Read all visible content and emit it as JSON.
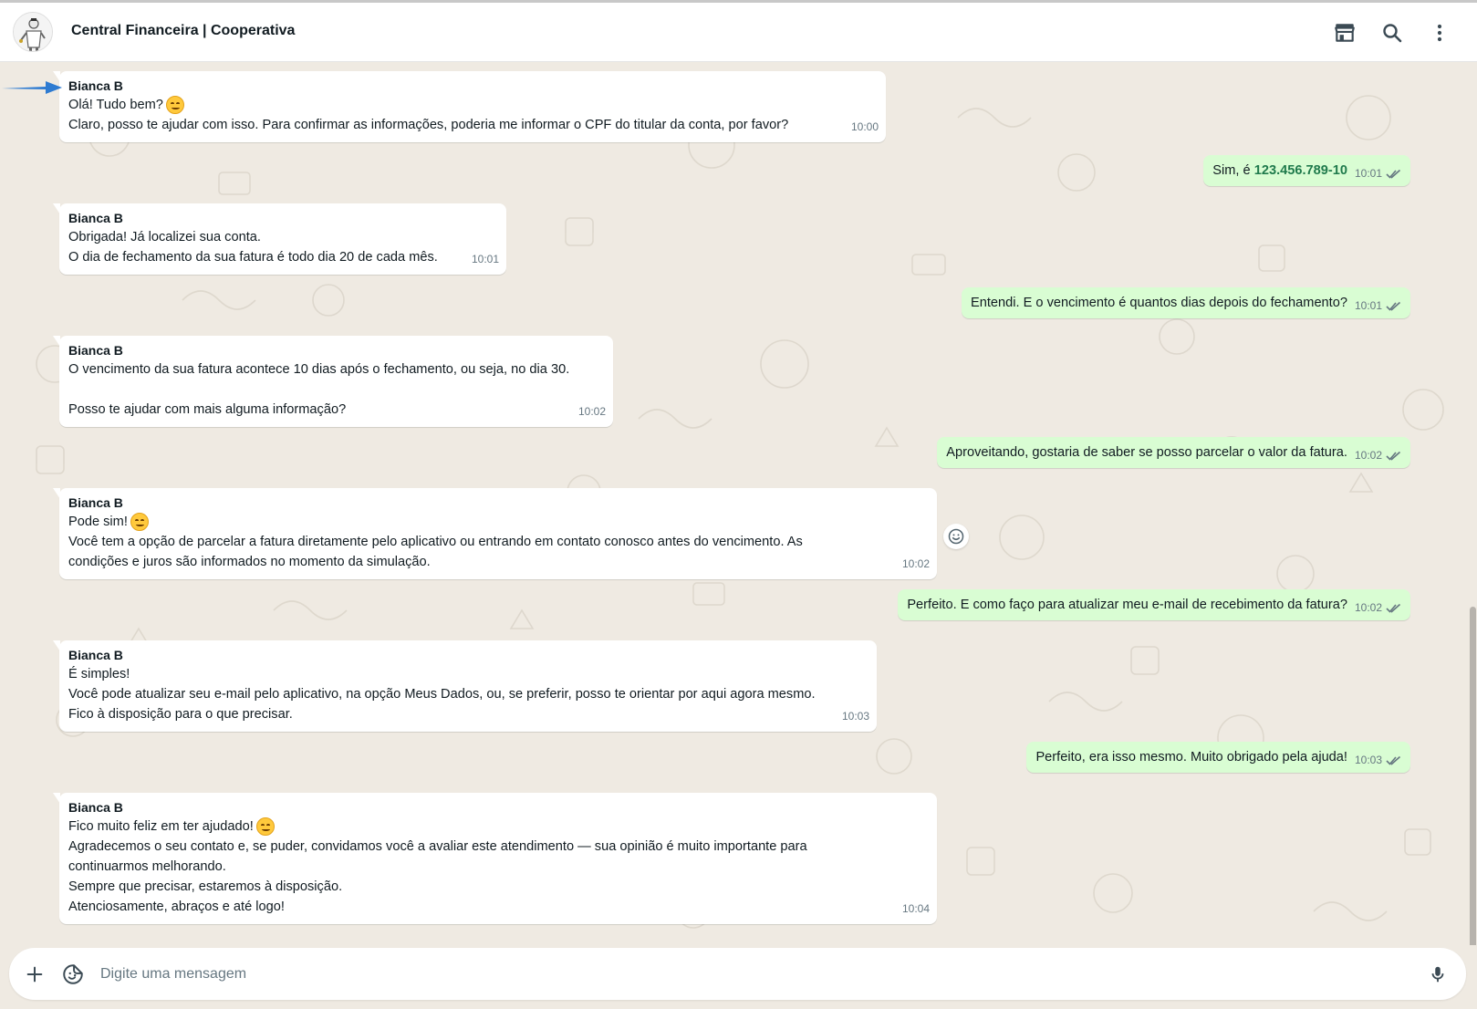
{
  "header": {
    "title": "Central Financeira | Cooperativa",
    "icons": [
      "store-icon",
      "search-icon",
      "more-vertical-icon"
    ]
  },
  "messages": [
    {
      "dir": "in",
      "sender": "Bianca B",
      "lines": [
        "Olá! Tudo bem?",
        "Claro, posso te ajudar com isso. Para confirmar as informações, poderia me informar o CPF do titular da conta, por favor?"
      ],
      "time": "10:00"
    },
    {
      "dir": "out",
      "text_prefix": "Sim, é ",
      "highlight": "123.456.789-10",
      "time": "10:01"
    },
    {
      "dir": "in",
      "sender": "Bianca B",
      "lines": [
        "Obrigada! Já localizei sua conta.",
        "O dia de fechamento da sua fatura é todo dia 20 de cada mês."
      ],
      "time": "10:01"
    },
    {
      "dir": "out",
      "text": "Entendi. E o vencimento é quantos dias depois do fechamento?",
      "time": "10:01"
    },
    {
      "dir": "in",
      "sender": "Bianca B",
      "lines": [
        "O vencimento da sua fatura acontece 10 dias após o fechamento, ou seja, no dia 30.",
        "",
        "Posso te ajudar com mais alguma informação?"
      ],
      "time": "10:02"
    },
    {
      "dir": "out",
      "text": "Aproveitando, gostaria de saber se posso parcelar o valor da fatura.",
      "time": "10:02"
    },
    {
      "dir": "in",
      "sender": "Bianca B",
      "lines": [
        "Pode sim!",
        "Você tem a opção de parcelar a fatura diretamente pelo aplicativo ou entrando em contato conosco antes do vencimento. As",
        "condições e juros são informados no momento da simulação."
      ],
      "time": "10:02"
    },
    {
      "dir": "out",
      "text": "Perfeito. E como faço para atualizar meu e-mail de recebimento da fatura?",
      "time": "10:02"
    },
    {
      "dir": "in",
      "sender": "Bianca B",
      "lines": [
        "É simples!",
        "Você pode atualizar seu e-mail pelo aplicativo, na opção Meus Dados, ou, se preferir, posso te orientar por aqui agora mesmo.",
        "Fico à disposição para o que precisar."
      ],
      "time": "10:03"
    },
    {
      "dir": "out",
      "text": "Perfeito, era isso mesmo. Muito obrigado pela ajuda!",
      "time": "10:03"
    },
    {
      "dir": "in",
      "sender": "Bianca B",
      "lines": [
        "Fico muito feliz em ter ajudado!",
        "Agradecemos o seu contato e, se puder, convidamos você a avaliar este atendimento — sua opinião é muito importante para",
        "continuarmos melhorando.",
        "Sempre que precisar, estaremos à disposição.",
        "Atenciosamente, abraços e até logo!"
      ],
      "time": "10:04"
    }
  ],
  "composer": {
    "placeholder": "Digite uma mensagem"
  },
  "colors": {
    "chat_bg": "#efeae2",
    "incoming_bubble": "#ffffff",
    "outgoing_bubble": "#d9fdd3",
    "highlight_text": "#1f7a4c"
  }
}
